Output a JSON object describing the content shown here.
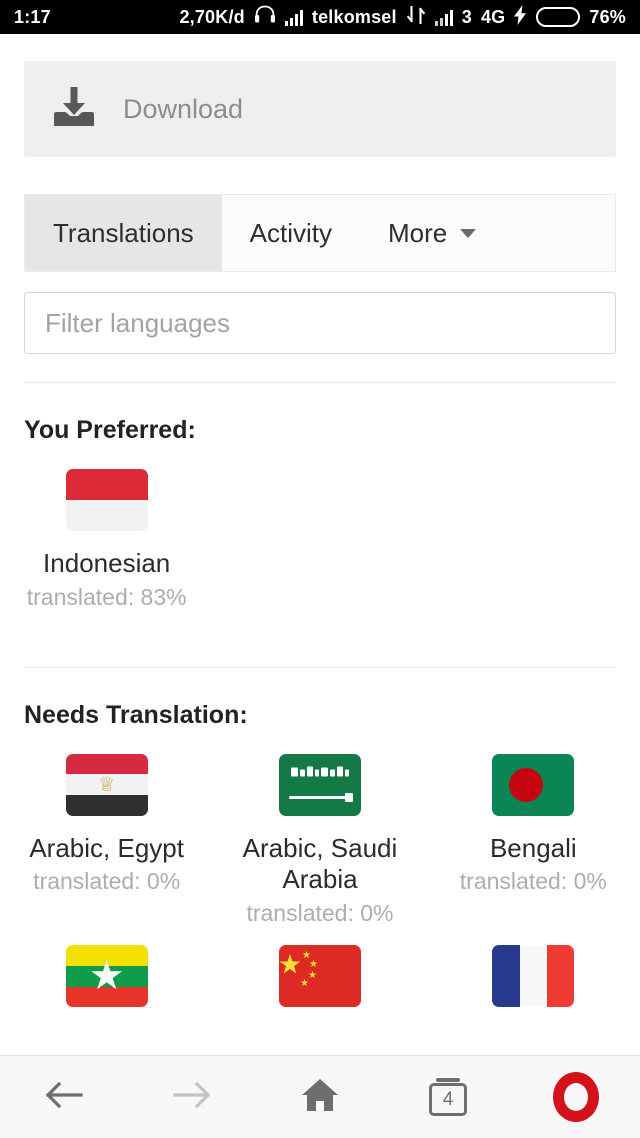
{
  "statusbar": {
    "clock": "1:17",
    "datarate": "2,70K/d",
    "headphone_icon": "headphone-icon",
    "signal_icon": "signal-bars-icon",
    "carrier": "telkomsel",
    "datatransfer_icon": "data-transfer-icon",
    "signal2_icon": "signal-bars-icon",
    "sim_slot": "3",
    "network": "4G",
    "charging_icon": "lightning-bolt-icon",
    "battery_icon": "battery-icon",
    "battery": "76%"
  },
  "download": {
    "label": "Download",
    "icon": "download-tray-icon"
  },
  "tabs": [
    {
      "label": "Translations",
      "active": true
    },
    {
      "label": "Activity",
      "active": false
    },
    {
      "label": "More",
      "active": false,
      "caret": "chevron-down-icon"
    }
  ],
  "filter": {
    "placeholder": "Filter languages",
    "value": ""
  },
  "sections": [
    {
      "title": "You Preferred:",
      "languages": [
        {
          "name": "Indonesian",
          "percent": "translated: 83%",
          "flag": "indonesia-flag"
        }
      ]
    },
    {
      "title": "Needs Translation:",
      "languages": [
        {
          "name": "Arabic, Egypt",
          "percent": "translated: 0%",
          "flag": "egypt-flag"
        },
        {
          "name": "Arabic, Saudi Arabia",
          "percent": "translated: 0%",
          "flag": "saudi-arabia-flag"
        },
        {
          "name": "Bengali",
          "percent": "translated: 0%",
          "flag": "bangladesh-flag"
        },
        {
          "name": "",
          "percent": "",
          "flag": "myanmar-flag"
        },
        {
          "name": "",
          "percent": "",
          "flag": "china-flag"
        },
        {
          "name": "",
          "percent": "",
          "flag": "france-flag"
        }
      ]
    }
  ],
  "navbar": {
    "back": "back-arrow-icon",
    "forward": "forward-arrow-icon",
    "home": "home-icon",
    "tabs_count": "4",
    "opera": "opera-logo-icon"
  },
  "colors": {
    "accent_red": "#d4121c",
    "battery_green": "#39d12a",
    "tab_active_bg": "#e6e6e6",
    "download_bg": "#efefef"
  }
}
